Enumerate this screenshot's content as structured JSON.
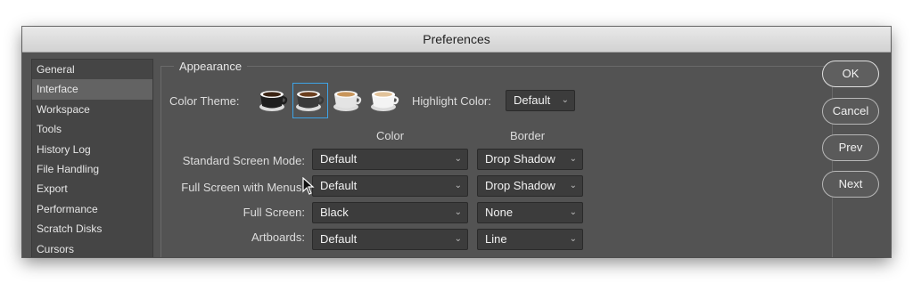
{
  "window": {
    "title": "Preferences"
  },
  "sidebar": {
    "items": [
      {
        "label": "General"
      },
      {
        "label": "Interface",
        "selected": true
      },
      {
        "label": "Workspace"
      },
      {
        "label": "Tools"
      },
      {
        "label": "History Log"
      },
      {
        "label": "File Handling"
      },
      {
        "label": "Export"
      },
      {
        "label": "Performance"
      },
      {
        "label": "Scratch Disks"
      },
      {
        "label": "Cursors"
      }
    ]
  },
  "appearance": {
    "legend": "Appearance",
    "color_theme_label": "Color Theme:",
    "themes": [
      {
        "icon": "dark-coffee-cup-icon",
        "selected": false
      },
      {
        "icon": "medium-dark-coffee-cup-icon",
        "selected": true
      },
      {
        "icon": "medium-light-coffee-cup-icon",
        "selected": false
      },
      {
        "icon": "light-coffee-cup-icon",
        "selected": false
      }
    ],
    "highlight_label": "Highlight Color:",
    "highlight_value": "Default",
    "color_header": "Color",
    "border_header": "Border",
    "rows": [
      {
        "label": "Standard Screen Mode:",
        "color": "Default",
        "border": "Drop Shadow"
      },
      {
        "label": "Full Screen with Menus:",
        "color": "Default",
        "border": "Drop Shadow"
      },
      {
        "label": "Full Screen:",
        "color": "Black",
        "border": "None"
      },
      {
        "label": "Artboards:",
        "color": "Default",
        "border": "Line"
      }
    ]
  },
  "buttons": {
    "ok": "OK",
    "cancel": "Cancel",
    "prev": "Prev",
    "next": "Next"
  },
  "colors": {
    "selection_accent": "#3ea3e6",
    "window_bg": "#535353"
  }
}
